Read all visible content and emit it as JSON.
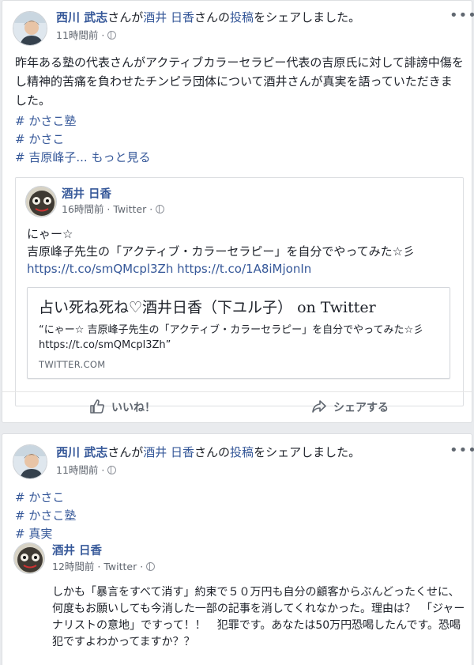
{
  "post1": {
    "author": "西川 武志",
    "share_mid": "さんが",
    "source_author": "酒井 日香",
    "share_of": "さんの",
    "post_word": "投稿",
    "share_end": "をシェアしました。",
    "time": "11時間前",
    "more": "•••",
    "body": "昨年ある塾の代表さんがアクティブカラーセラピー代表の吉原氏に対して誹謗中傷をし精神的苦痛を負わせたチンピラ団体について酒井さんが真実を語っていただきました。",
    "hashtags": [
      "# かさこ塾",
      "# かさこ",
      "# 吉原峰子..."
    ],
    "see_more": "もっと見る",
    "embed": {
      "name": "酒井 日香",
      "time": "16時間前",
      "source": "Twitter",
      "line1": "にゃー☆",
      "line2": "吉原峰子先生の「アクティブ・カラーセラピー」を自分でやってみた☆彡",
      "url1": "https://t.co/smQMcpl3Zh",
      "url2": "https://t.co/1A8iMjonIn",
      "card_title": "占い死ね死ね♡酒井日香（下ユル子） on Twitter",
      "card_desc": "“にゃー☆ 吉原峰子先生の「アクティブ・カラーセラピー」を自分でやってみた☆彡 https://t.co/smQMcpl3Zh”",
      "card_domain": "TWITTER.COM"
    },
    "like_label": "いいね！",
    "share_label": "シェアする"
  },
  "post2": {
    "author": "西川 武志",
    "share_mid": "さんが",
    "source_author": "酒井 日香",
    "share_of": "さんの",
    "post_word": "投稿",
    "share_end": "をシェアしました。",
    "time": "11時間前",
    "more": "•••",
    "hashtags": [
      "# かさこ",
      "# かさこ塾",
      "# 真実"
    ],
    "reshare": {
      "name": "酒井 日香",
      "time": "12時間前",
      "source": "Twitter",
      "text": "しかも「暴言をすべて消す」約束で５０万円も自分の顧客からぶんどったくせに、何度もお願いしても今消した一部の記事を消してくれなかった。理由は？　「ジャーナリストの意地」ですって！！　犯罪です。あなたは50万円恐喝したんです。恐喝犯ですよわかってますか？？"
    }
  }
}
